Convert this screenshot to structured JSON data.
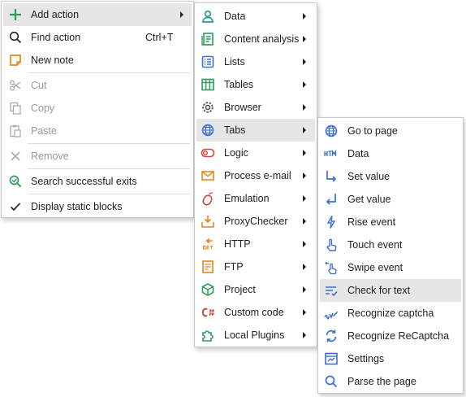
{
  "main_menu": {
    "add_action": "Add action",
    "find_action": "Find action",
    "find_action_shortcut": "Ctrl+T",
    "new_note": "New note",
    "cut": "Cut",
    "copy": "Copy",
    "paste": "Paste",
    "remove": "Remove",
    "search_exits": "Search successful exits",
    "display_static": "Display static blocks"
  },
  "add_action_menu": {
    "items": [
      "Data",
      "Content analysis",
      "Lists",
      "Tables",
      "Browser",
      "Tabs",
      "Logic",
      "Process e-mail",
      "Emulation",
      "ProxyChecker",
      "HTTP",
      "FTP",
      "Project",
      "Custom code",
      "Local Plugins"
    ],
    "highlighted": "Tabs"
  },
  "tabs_menu": {
    "items": [
      "Go to page",
      "Data",
      "Set value",
      "Get value",
      "Rise event",
      "Touch event",
      "Swipe event",
      "Check for text",
      "Recognize captcha",
      "Recognize ReCaptcha",
      "Settings",
      "Parse the page"
    ],
    "highlighted": "Check for text"
  },
  "icons": {
    "add": "plus-icon",
    "find": "search-icon",
    "note": "note-icon",
    "cut": "scissors-icon",
    "copy": "copy-icon",
    "paste": "paste-icon",
    "remove": "close-icon",
    "search_exits": "search-check-icon",
    "display_static": "check-icon"
  },
  "colors": {
    "highlight": "#e6e6e6",
    "green": "#2e9e5b",
    "blue": "#3b6fd6",
    "orange": "#e8861a",
    "red": "#d9453c",
    "teal": "#1e9e8e",
    "disabled": "#999999"
  }
}
